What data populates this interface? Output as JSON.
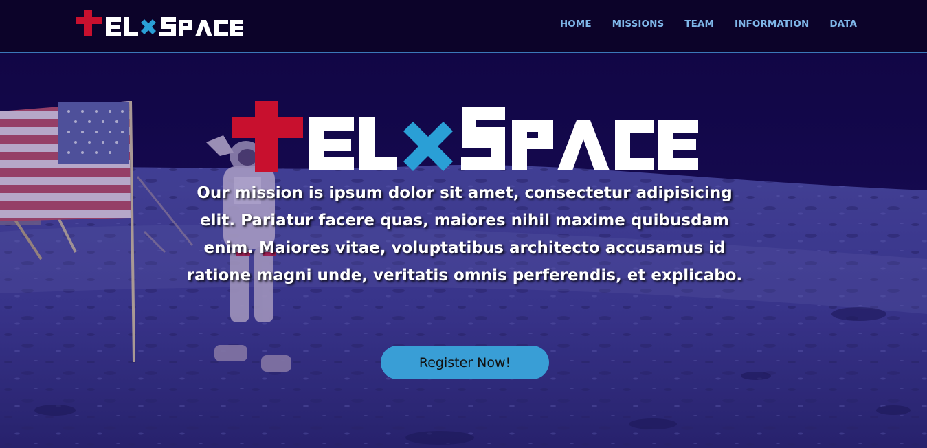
{
  "brand": {
    "name_prefix": "EL",
    "name_suffix": "SPACE",
    "cross_color": "#c8102e",
    "x_color": "#2a9fd6",
    "text_color": "#ffffff"
  },
  "nav": {
    "items": [
      {
        "label": "HOME"
      },
      {
        "label": "MISSIONS"
      },
      {
        "label": "TEAM"
      },
      {
        "label": "INFORMATION"
      },
      {
        "label": "DATA"
      }
    ],
    "link_color": "#7fb6e8",
    "border_color": "#3b78b8"
  },
  "hero": {
    "mission_text": "Our mission is ipsum dolor sit amet, consectetur adipisicing elit. Pariatur facere quas, maiores nihil maxime quibusdam enim. Maiores vitae, voluptatibus architecto accusamus id ratione magni unde, veritatis omnis perferendis, et explicabo.",
    "cta_label": "Register Now!",
    "cta_color": "#399ed6",
    "background_image": "astronaut-on-moon-with-flag"
  }
}
